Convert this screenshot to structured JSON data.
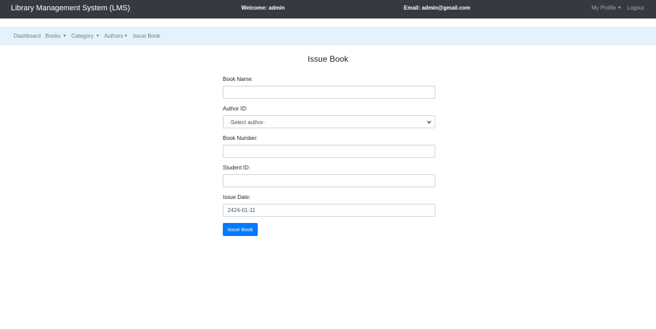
{
  "header": {
    "brand": "Library Management System (LMS)",
    "welcome": "Welcome: admin",
    "email": "Email: admin@gmail.com",
    "profile": "My Profile",
    "logout": "Logout"
  },
  "nav": {
    "dashboard": "Dashboard",
    "books": "Books",
    "category": "Category",
    "authors": "Authors",
    "issue_book": "Issue Book"
  },
  "page": {
    "title": "Issue Book"
  },
  "form": {
    "book_name_label": "Book Name:",
    "book_name_value": "",
    "author_id_label": "Author ID:",
    "author_id_selected": "-Select author-",
    "book_number_label": "Book Number:",
    "book_number_value": "",
    "student_id_label": "Student ID:",
    "student_id_value": "",
    "issue_date_label": "Issue Date:",
    "issue_date_value": "2424-01-11",
    "submit_label": "Issue Book"
  },
  "colors": {
    "topbar": "#343a40",
    "subnav": "#e3f2fd",
    "primary": "#007bff"
  },
  "icons": {
    "dropdown": "caret-down-icon",
    "select": "chevron-down-icon"
  }
}
